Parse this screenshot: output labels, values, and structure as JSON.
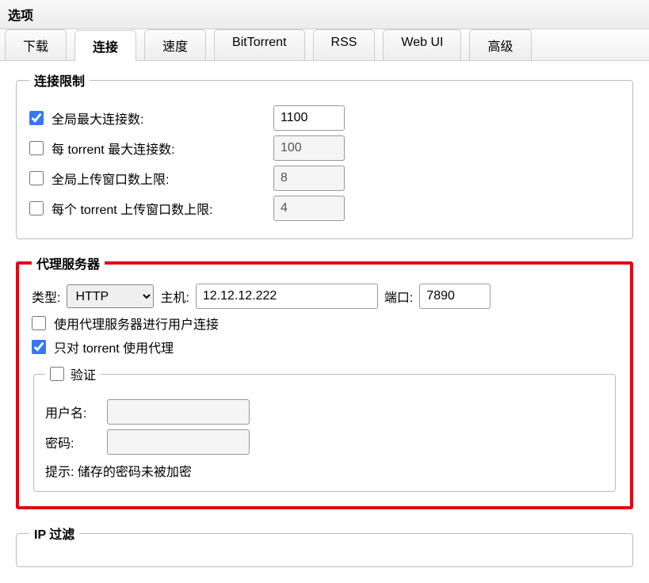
{
  "window": {
    "title": "选项"
  },
  "tabs": {
    "download": "下载",
    "connection": "连接",
    "speed": "速度",
    "bittorrent": "BitTorrent",
    "rss": "RSS",
    "webui": "Web UI",
    "advanced": "高级"
  },
  "conn_limits": {
    "legend": "连接限制",
    "global_max": {
      "label": "全局最大连接数:",
      "value": "1100",
      "checked": true
    },
    "per_torrent_max": {
      "label": "每 torrent 最大连接数:",
      "value": "100",
      "checked": false
    },
    "global_upload_slots": {
      "label": "全局上传窗口数上限:",
      "value": "8",
      "checked": false
    },
    "per_torrent_upload_slots": {
      "label": "每个 torrent 上传窗口数上限:",
      "value": "4",
      "checked": false
    }
  },
  "proxy": {
    "legend": "代理服务器",
    "type_label": "类型:",
    "type_value": "HTTP",
    "host_label": "主机:",
    "host_value": "12.12.12.222",
    "port_label": "端口:",
    "port_value": "7890",
    "peer_conn": {
      "label": "使用代理服务器进行用户连接",
      "checked": false
    },
    "only_torrent": {
      "label": "只对 torrent 使用代理",
      "checked": true
    },
    "auth": {
      "legend": "验证",
      "checked": false,
      "user_label": "用户名:",
      "user_value": "",
      "pass_label": "密码:",
      "pass_value": "",
      "hint_label": "提示:",
      "hint_text": "储存的密码未被加密"
    }
  },
  "ipfilter": {
    "legend": "IP 过滤"
  }
}
